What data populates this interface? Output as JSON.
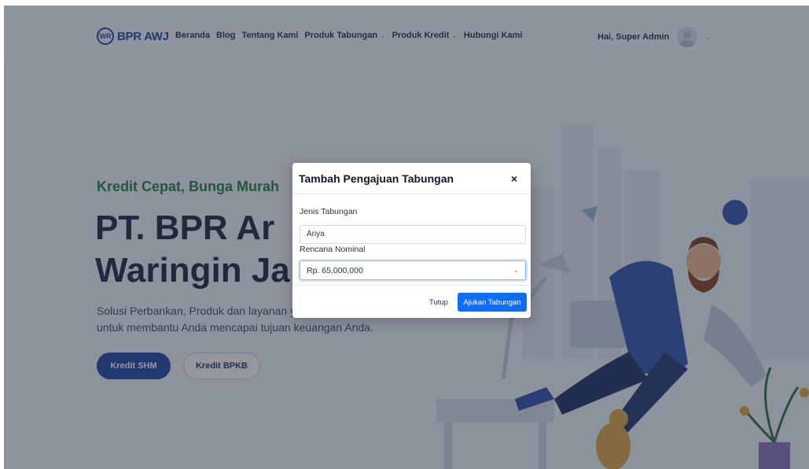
{
  "navbar": {
    "brand_mark": "WR",
    "brand_name": "BPR AWJ",
    "items": [
      {
        "label": "Beranda",
        "dropdown": false
      },
      {
        "label": "Blog",
        "dropdown": false
      },
      {
        "label": "Tentang Kami",
        "dropdown": false
      },
      {
        "label": "Produk Tabungan",
        "dropdown": true
      },
      {
        "label": "Produk Kredit",
        "dropdown": true
      },
      {
        "label": "Hubungi Kami",
        "dropdown": false
      }
    ],
    "user_greeting": "Hai, Super Admin",
    "chevron_icon": "chevron-down-icon"
  },
  "hero": {
    "tagline": "Kredit Cepat, Bunga Murah",
    "title_line1": "PT. BPR Ar",
    "title_line2": "Waringin Ja",
    "description_line1": "Solusi Perbankan, Produk dan layanan y",
    "description_line2": "untuk membantu Anda mencapai tujuan keuangan Anda.",
    "primary_button": "Kredit SHM",
    "secondary_button": "Kredit BPKB"
  },
  "modal": {
    "title": "Tambah Pengajuan Tabungan",
    "close_symbol": "×",
    "jenis_label": "Jenis Tabungan",
    "jenis_value": "Ariya",
    "nominal_label": "Rencana Nominal",
    "nominal_value": "Rp. 65,000,000",
    "cancel_button": "Tutup",
    "submit_button": "Ajukan Tabungan"
  },
  "colors": {
    "brand_blue": "#1f3c9e",
    "accent_green": "#1e7a3c",
    "primary_button": "#0d6efd",
    "backdrop": "rgba(40,50,65,0.5)"
  }
}
